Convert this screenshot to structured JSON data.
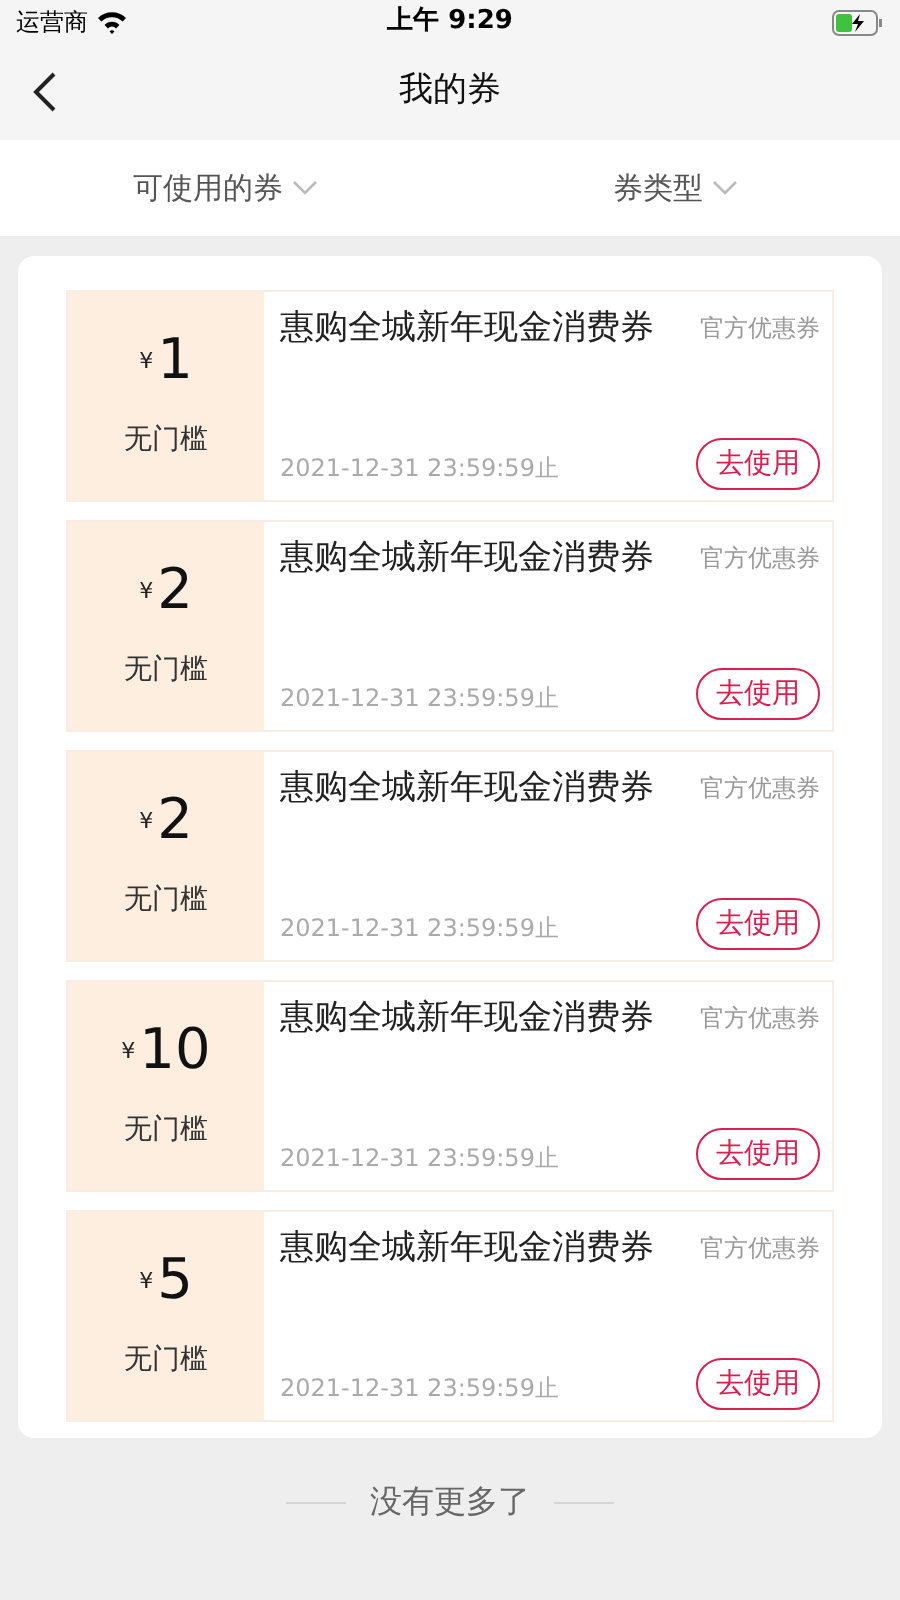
{
  "status_bar": {
    "carrier": "运营商",
    "time": "上午 9:29"
  },
  "nav": {
    "title": "我的券"
  },
  "filters": [
    {
      "label": "可使用的券"
    },
    {
      "label": "券类型"
    }
  ],
  "coupons": [
    {
      "currency": "¥",
      "amount": "1",
      "threshold": "无门槛",
      "title": "惠购全城新年现金消费券",
      "tag": "官方优惠券",
      "expiry": "2021-12-31 23:59:59止",
      "button": "去使用"
    },
    {
      "currency": "¥",
      "amount": "2",
      "threshold": "无门槛",
      "title": "惠购全城新年现金消费券",
      "tag": "官方优惠券",
      "expiry": "2021-12-31 23:59:59止",
      "button": "去使用"
    },
    {
      "currency": "¥",
      "amount": "2",
      "threshold": "无门槛",
      "title": "惠购全城新年现金消费券",
      "tag": "官方优惠券",
      "expiry": "2021-12-31 23:59:59止",
      "button": "去使用"
    },
    {
      "currency": "¥",
      "amount": "10",
      "threshold": "无门槛",
      "title": "惠购全城新年现金消费券",
      "tag": "官方优惠券",
      "expiry": "2021-12-31 23:59:59止",
      "button": "去使用"
    },
    {
      "currency": "¥",
      "amount": "5",
      "threshold": "无门槛",
      "title": "惠购全城新年现金消费券",
      "tag": "官方优惠券",
      "expiry": "2021-12-31 23:59:59止",
      "button": "去使用"
    }
  ],
  "footer": "没有更多了"
}
